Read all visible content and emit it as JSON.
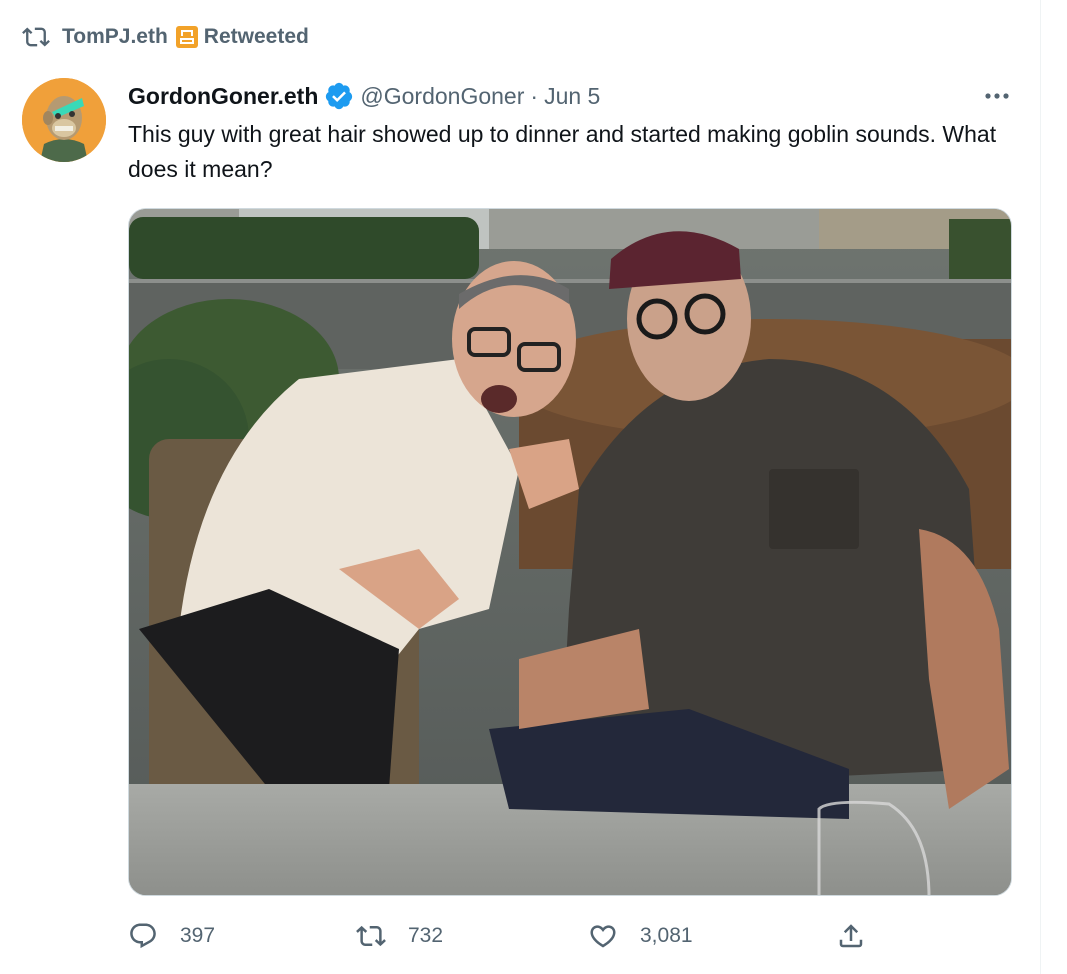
{
  "retweet_header": {
    "user": "TomPJ.eth",
    "label": "Retweeted"
  },
  "tweet": {
    "display_name": "GordonGoner.eth",
    "handle": "@GordonGoner",
    "separator": "·",
    "date": "Jun 5",
    "text": "This guy with great hair showed up to dinner and started making goblin sounds. What does it mean?"
  },
  "actions": {
    "replies": "397",
    "retweets": "732",
    "likes": "3,081"
  },
  "icons": {
    "retweet": "retweet-icon",
    "badge": "community-badge-icon",
    "verified": "verified-badge-icon",
    "more": "more-options-icon",
    "reply": "reply-icon",
    "like": "heart-icon",
    "share": "share-icon"
  },
  "colors": {
    "secondary_text": "#536471",
    "verified_blue": "#1d9bf0",
    "badge_orange": "#f2a229",
    "avatar_bg": "#f0a03a"
  }
}
